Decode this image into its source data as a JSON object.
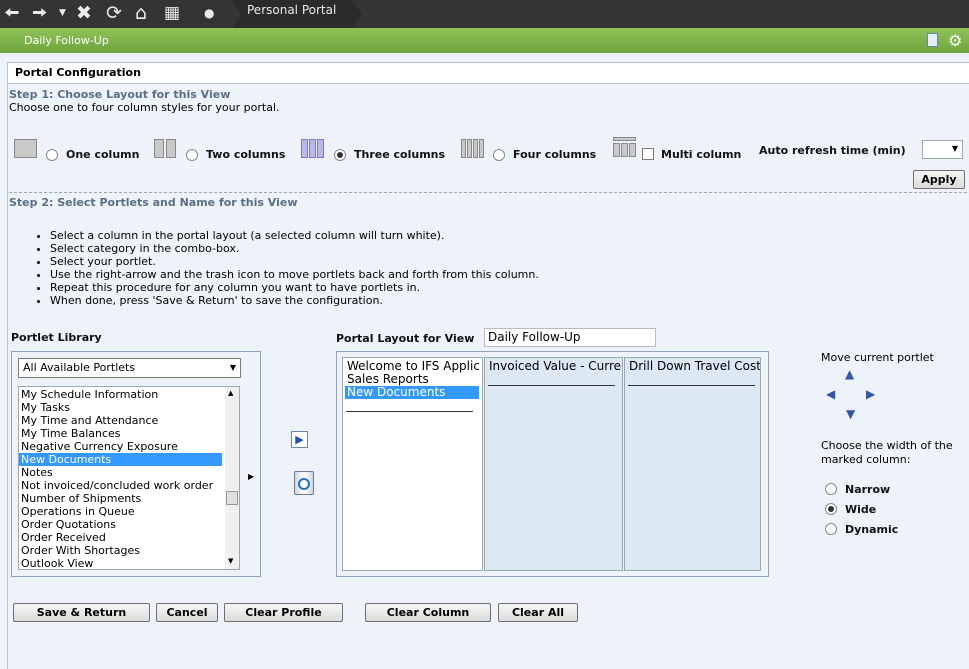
{
  "topbar": {
    "breadcrumb": "Personal Portal",
    "icons": [
      "back-arrow-icon",
      "forward-arrow-icon",
      "dropdown-icon",
      "close-icon",
      "refresh-icon",
      "home-icon",
      "grid-icon",
      "dot-icon"
    ]
  },
  "greenbar": {
    "title": "Daily Follow-Up",
    "icons": [
      "page-icon",
      "gear-icon"
    ]
  },
  "panel": {
    "title": "Portal Configuration"
  },
  "step1": {
    "title": "Step 1: Choose Layout for this View",
    "desc": "Choose one to four column styles for your portal.",
    "options": [
      "One column",
      "Two columns",
      "Three columns",
      "Four columns"
    ],
    "selected": "Three columns",
    "multi": "Multi column",
    "multi_checked": false,
    "refresh_label": "Auto refresh time (min)",
    "refresh_value": "",
    "apply": "Apply"
  },
  "step2": {
    "title": "Step 2: Select Portlets and Name for this View",
    "instructions": [
      "Select a column in the portal layout (a selected column will turn white).",
      "Select category in the combo-box.",
      "Select your portlet.",
      "Use the right-arrow and the trash icon to move portlets back and forth from this column.",
      "Repeat this procedure for any column you want to have portlets in.",
      "When done, press 'Save & Return' to save the configuration."
    ]
  },
  "library": {
    "label": "Portlet Library",
    "category": "All Available Portlets",
    "items": [
      "My Schedule Information",
      "My Tasks",
      "My Time and Attendance",
      "My Time Balances",
      "Negative Currency Exposure",
      "New Documents",
      "Notes",
      "Not invoiced/concluded work order",
      "Number of Shipments",
      "Operations in Queue",
      "Order Quotations",
      "Order Received",
      "Order With Shortages",
      "Outlook View"
    ],
    "selected": "New Documents"
  },
  "layout": {
    "label": "Portal Layout for View",
    "view_name": "Daily Follow-Up",
    "columns": [
      {
        "items": [
          "Welcome to IFS Applica",
          "Sales Reports",
          "New Documents"
        ],
        "selected": "New Documents"
      },
      {
        "items": [
          "Invoiced Value - Curre"
        ],
        "selected": ""
      },
      {
        "items": [
          "Drill Down Travel Cost"
        ],
        "selected": ""
      }
    ]
  },
  "side": {
    "move_label": "Move current portlet",
    "width_label": "Choose the width of the marked column:",
    "widths": [
      "Narrow",
      "Wide",
      "Dynamic"
    ],
    "width_selected": "Wide"
  },
  "buttons": {
    "save": "Save & Return",
    "cancel": "Cancel",
    "clear_profile": "Clear Profile",
    "clear_column": "Clear Column",
    "clear_all": "Clear All"
  }
}
